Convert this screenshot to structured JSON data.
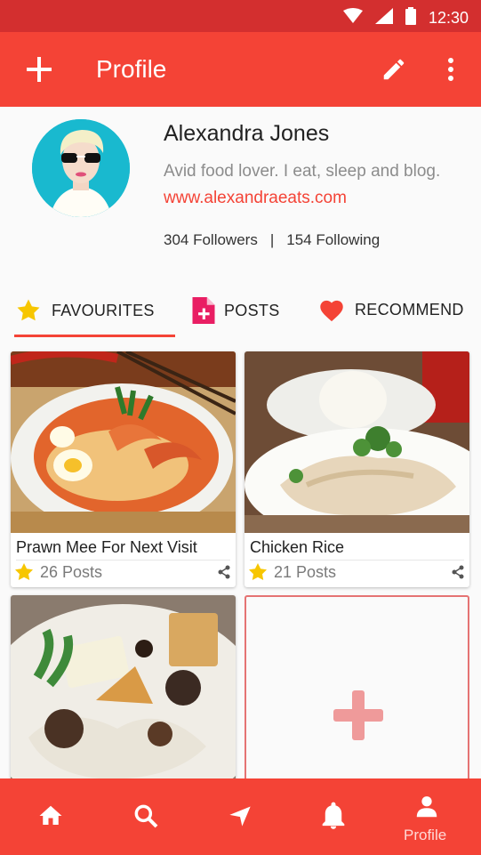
{
  "status_bar": {
    "time": "12:30"
  },
  "app_bar": {
    "title": "Profile"
  },
  "profile": {
    "name": "Alexandra Jones",
    "bio": "Avid food lover. I eat, sleep and blog.",
    "website": "www.alexandraeats.com",
    "followers": "304 Followers",
    "separator": "|",
    "following": "154 Following"
  },
  "tabs": [
    {
      "label": "FAVOURITES",
      "icon": "star-icon",
      "active": true
    },
    {
      "label": "POSTS",
      "icon": "post-add-icon",
      "active": false
    },
    {
      "label": "RECOMMEND",
      "icon": "heart-icon",
      "active": false
    }
  ],
  "cards": [
    {
      "title": "Prawn Mee For Next Visit",
      "posts": "26 Posts"
    },
    {
      "title": "Chicken Rice",
      "posts": "21 Posts"
    }
  ],
  "bottom_nav": {
    "active_label": "Profile"
  },
  "colors": {
    "primary": "#f44336",
    "status": "#d32f2f",
    "accent_star": "#f7c600",
    "link": "#f44336"
  }
}
